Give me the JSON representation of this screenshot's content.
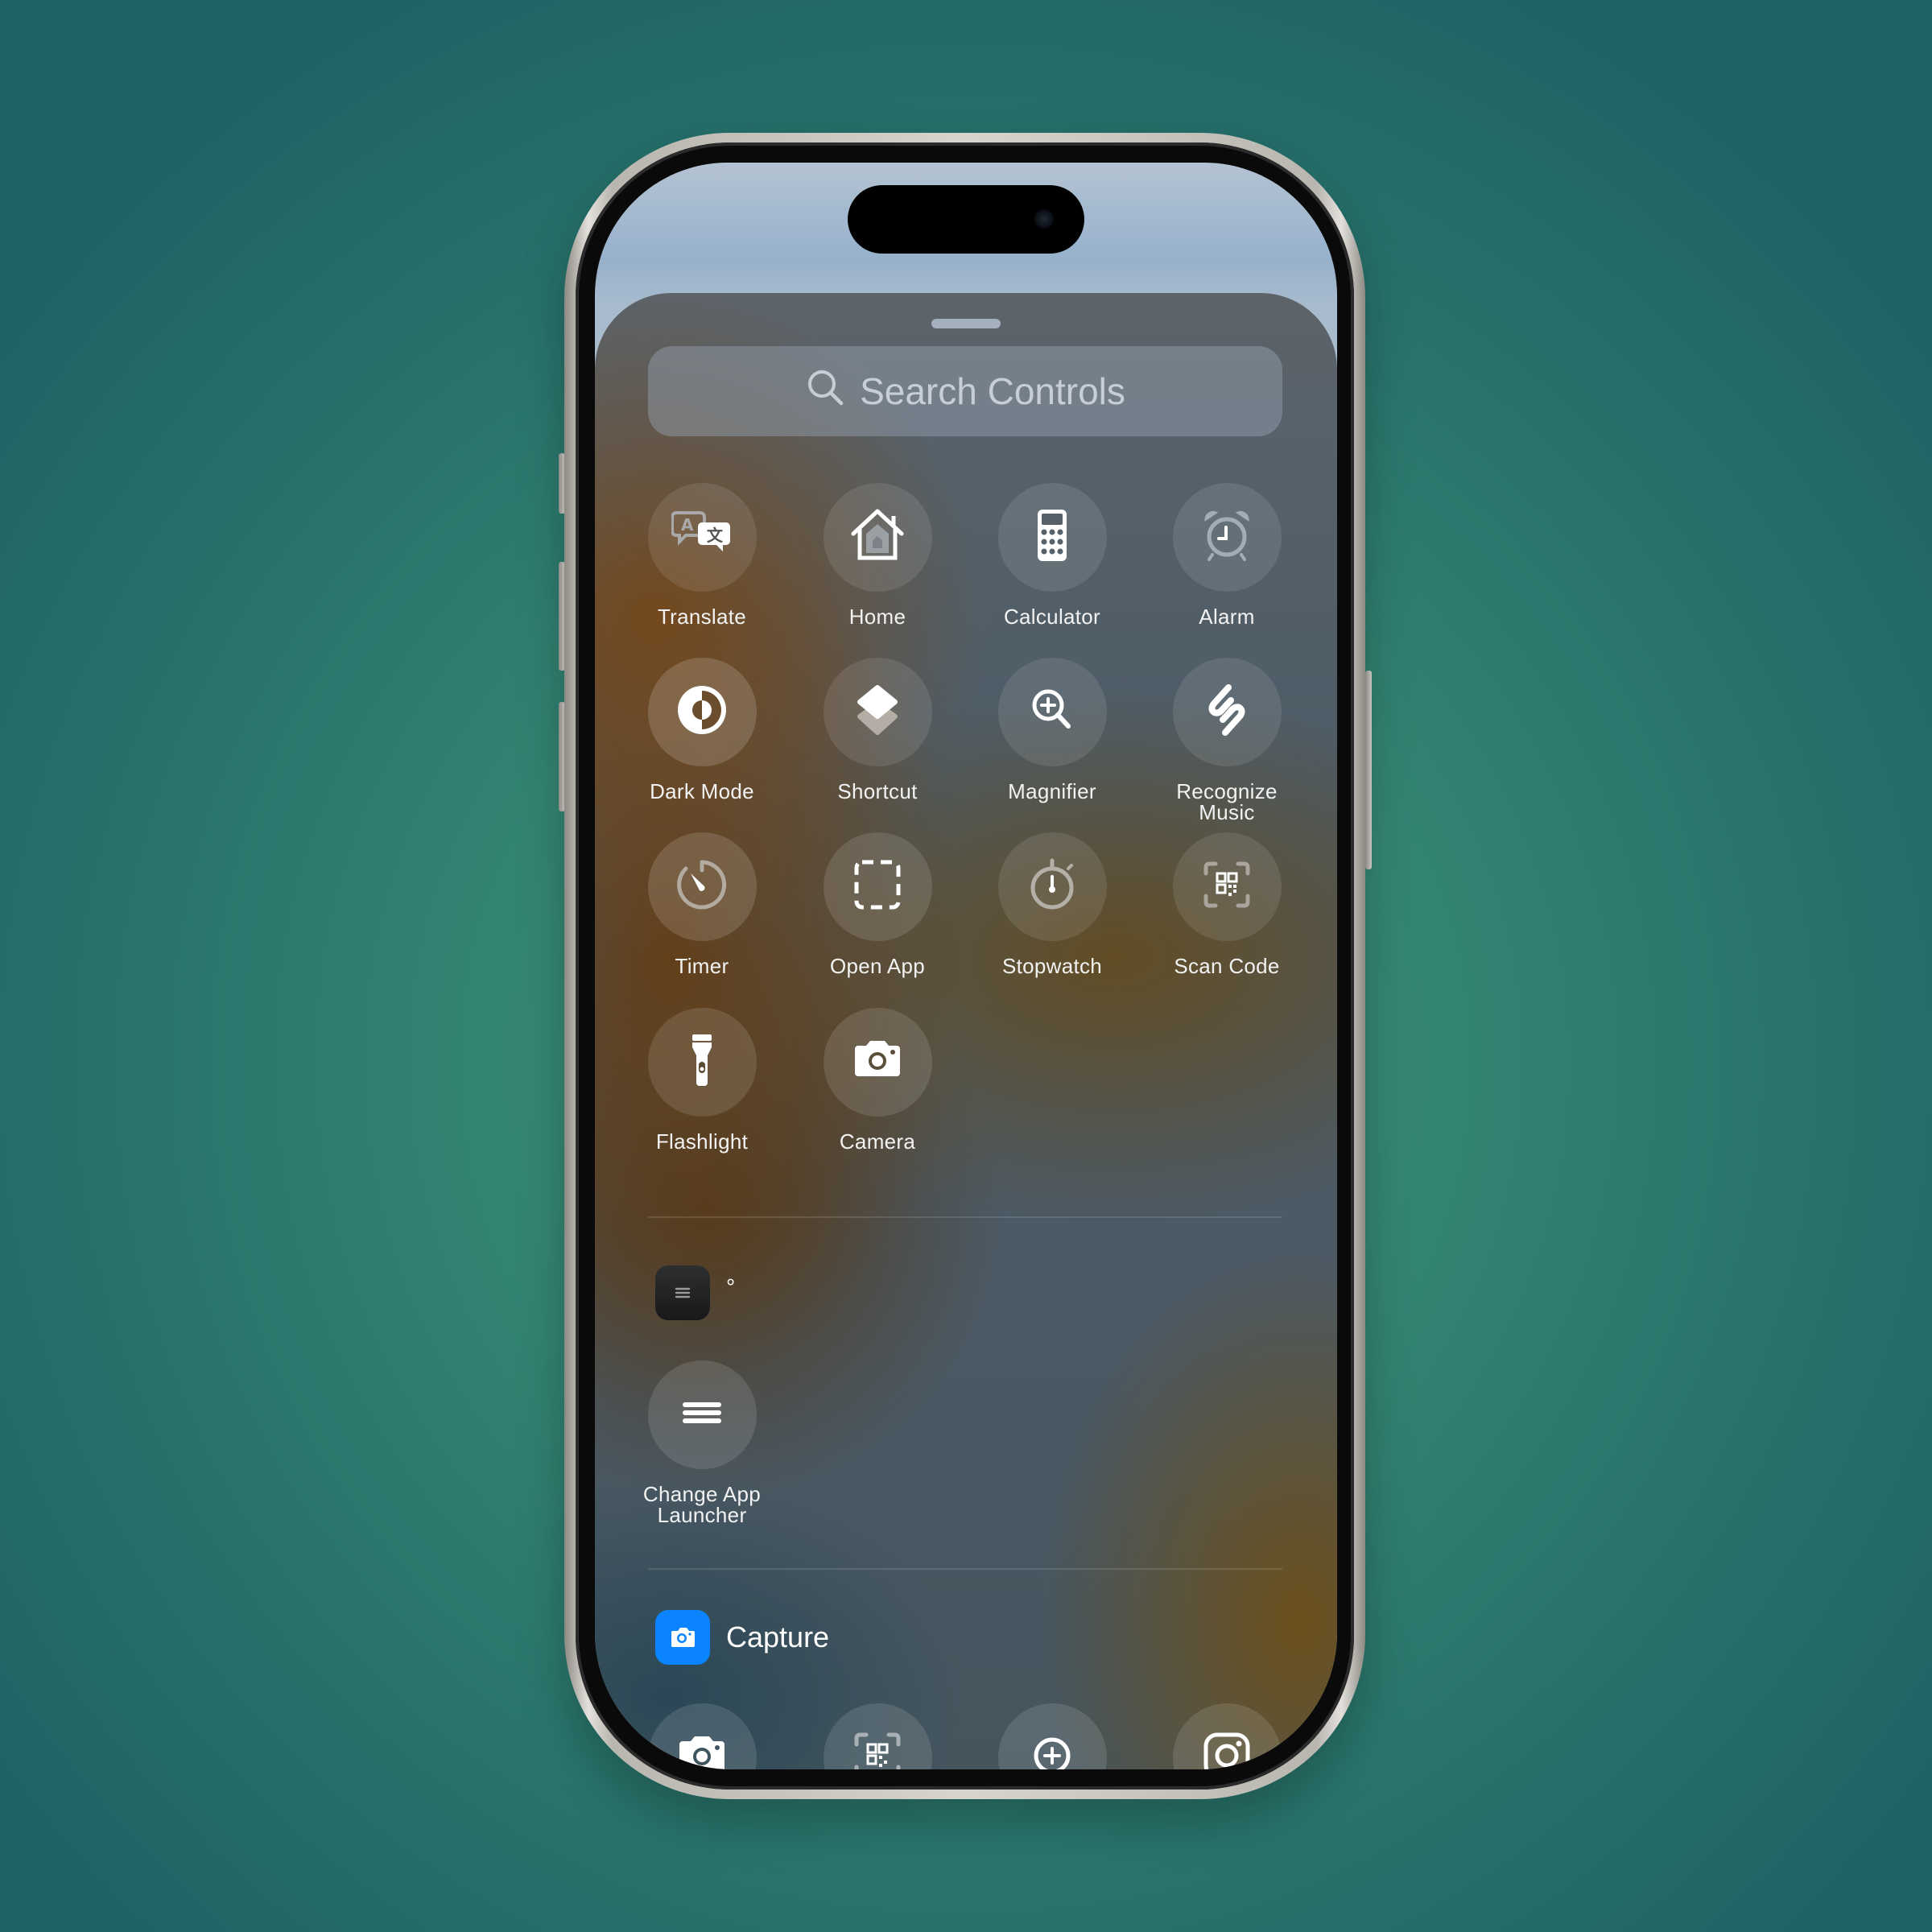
{
  "search": {
    "placeholder": "Search Controls",
    "icon": "search-icon"
  },
  "controls": [
    {
      "label": "Translate",
      "icon": "translate-icon"
    },
    {
      "label": "Home",
      "icon": "home-icon"
    },
    {
      "label": "Calculator",
      "icon": "calculator-icon"
    },
    {
      "label": "Alarm",
      "icon": "alarm-icon"
    },
    {
      "label": "Dark Mode",
      "icon": "dark-mode-icon"
    },
    {
      "label": "Shortcut",
      "icon": "shortcuts-icon"
    },
    {
      "label": "Magnifier",
      "icon": "magnifier-icon"
    },
    {
      "label": "Recognize Music",
      "icon": "shazam-icon"
    },
    {
      "label": "Timer",
      "icon": "timer-icon"
    },
    {
      "label": "Open App",
      "icon": "open-app-icon"
    },
    {
      "label": "Stopwatch",
      "icon": "stopwatch-icon"
    },
    {
      "label": "Scan Code",
      "icon": "qr-code-icon"
    },
    {
      "label": "Flashlight",
      "icon": "flashlight-icon"
    },
    {
      "label": "Camera",
      "icon": "camera-icon"
    }
  ],
  "sections": [
    {
      "app_name": "°",
      "app_icon": "launcher-app-icon",
      "controls": [
        {
          "label": "Change App Launcher",
          "icon": "menu-lines-icon"
        }
      ]
    },
    {
      "app_name": "Capture",
      "app_icon": "capture-camera-app-icon",
      "app_icon_color": "#0a84ff",
      "controls": [
        {
          "label": "",
          "icon": "camera-icon"
        },
        {
          "label": "",
          "icon": "qr-code-icon"
        },
        {
          "label": "",
          "icon": "add-circle-icon"
        },
        {
          "label": "",
          "icon": "instagram-icon"
        }
      ]
    }
  ]
}
